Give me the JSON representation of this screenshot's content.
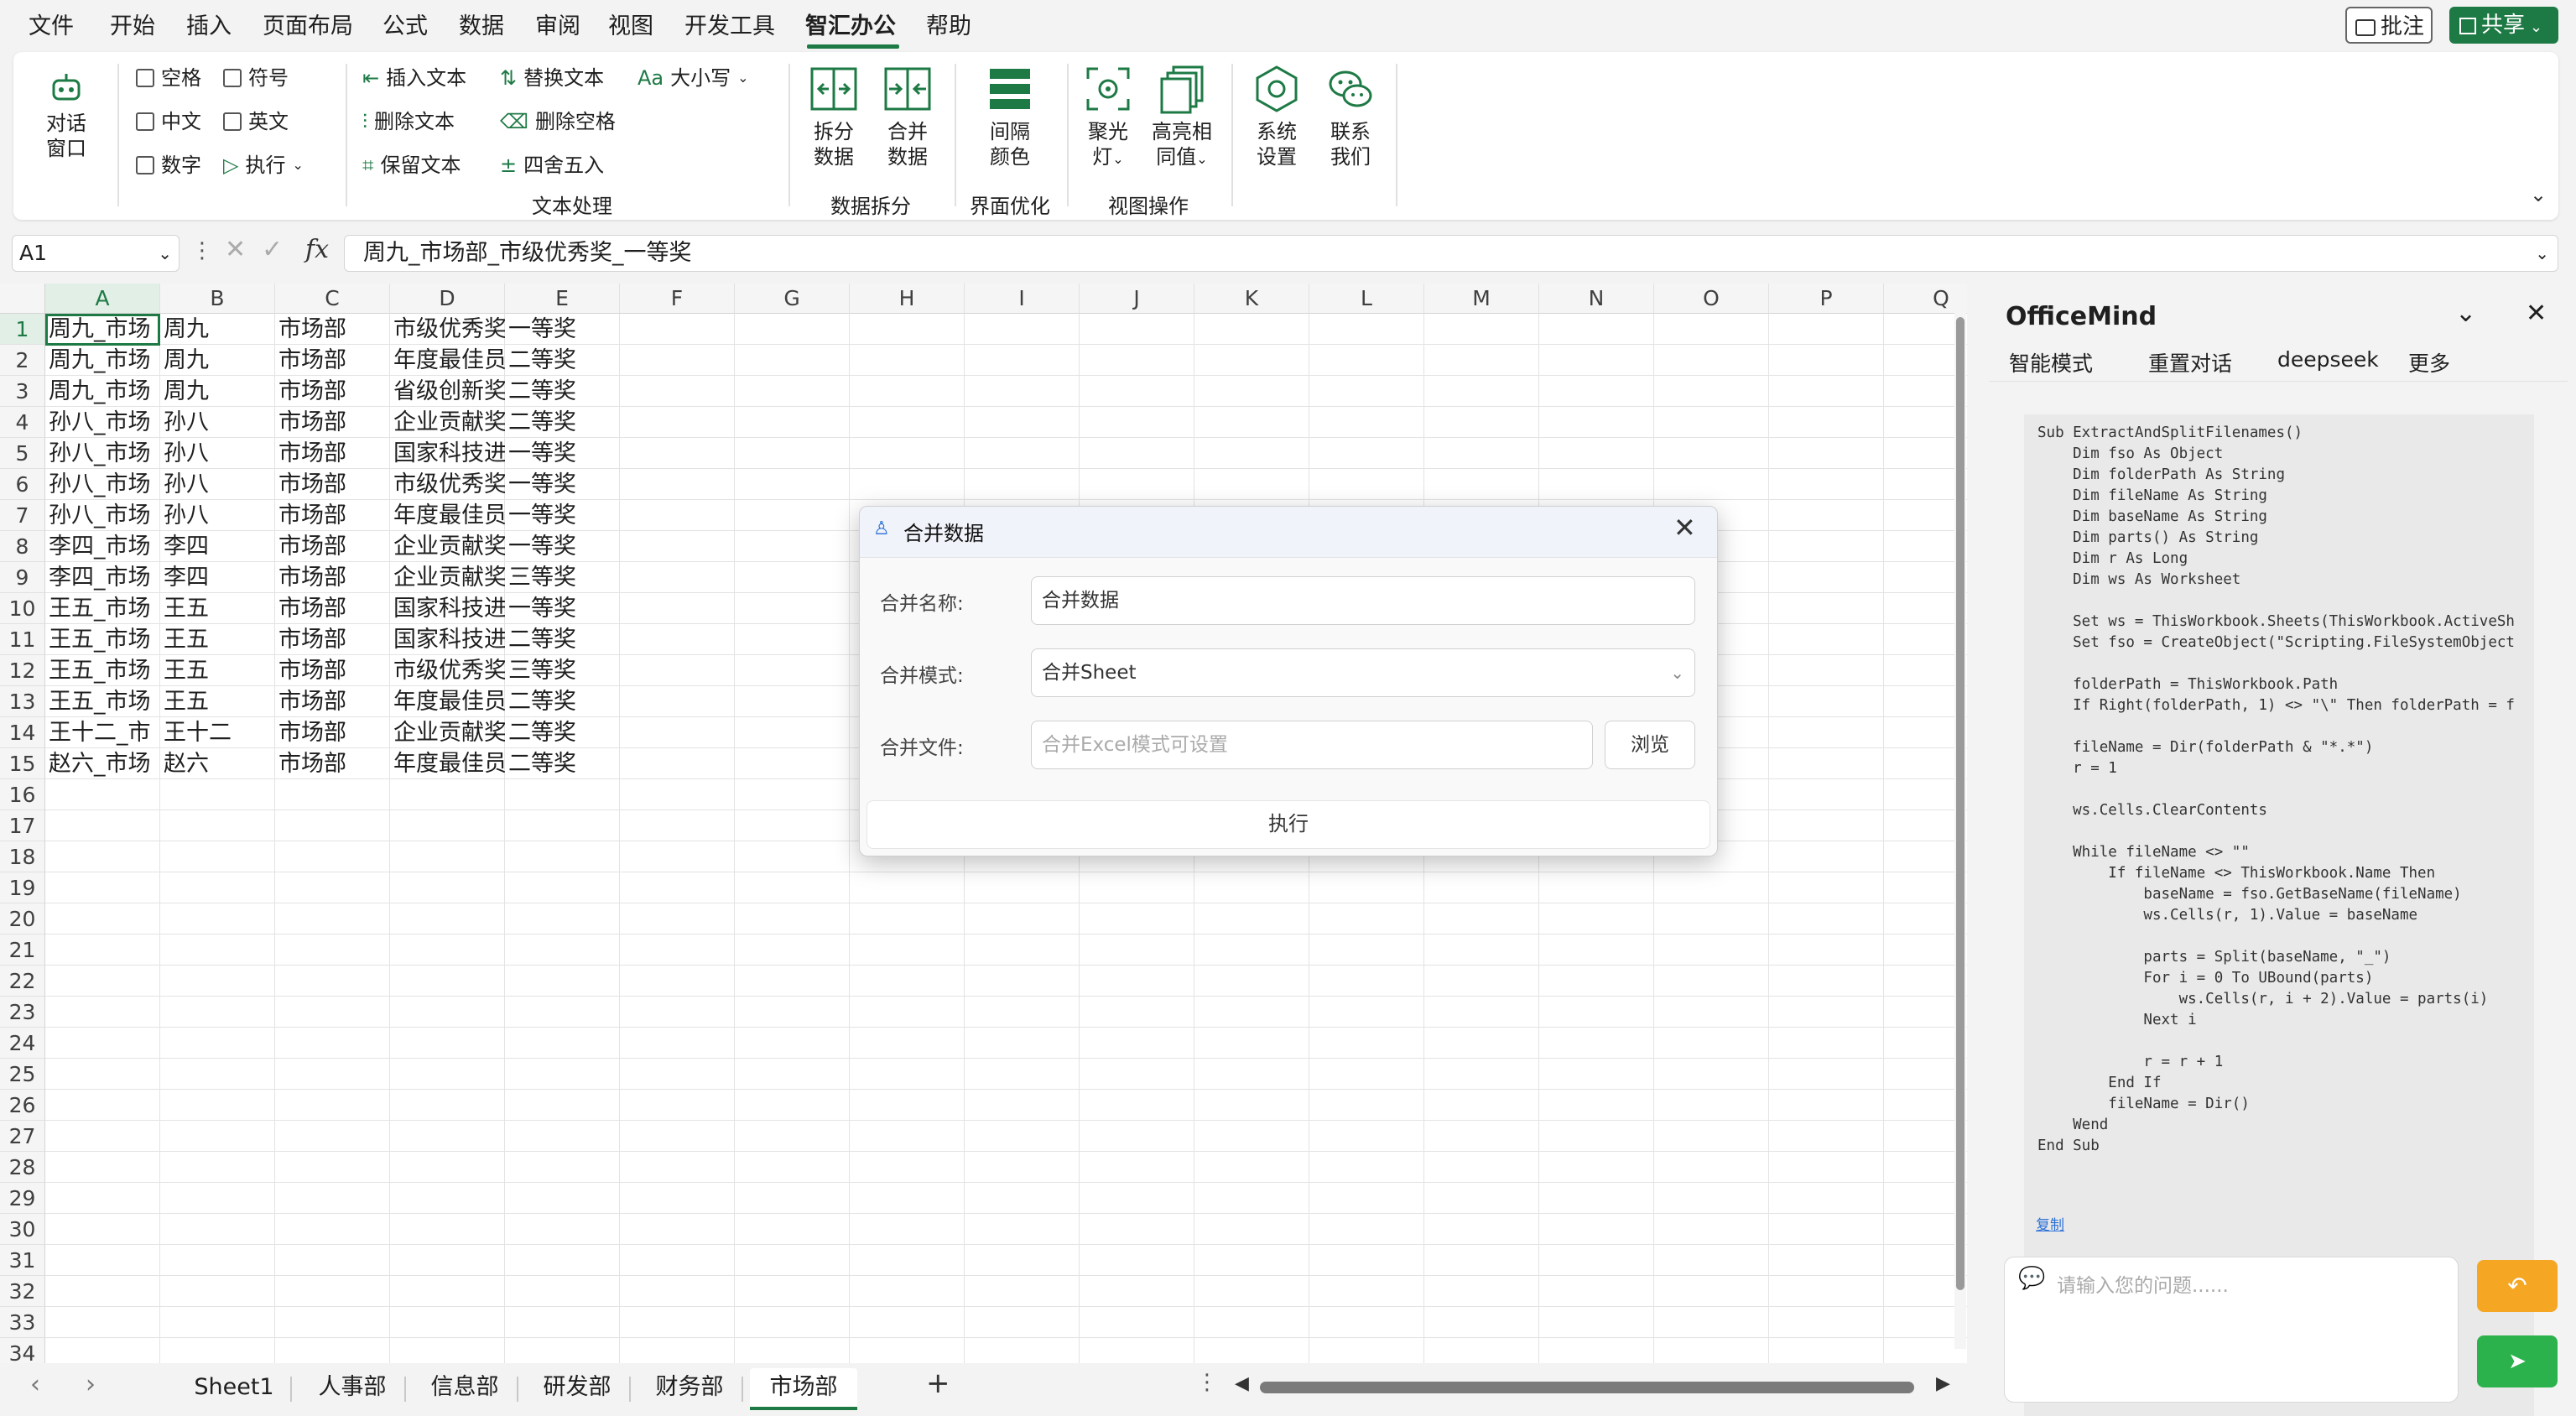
{
  "menu": {
    "items": [
      "文件",
      "开始",
      "插入",
      "页面布局",
      "公式",
      "数据",
      "审阅",
      "视图",
      "开发工具",
      "智汇办公",
      "帮助"
    ],
    "active": "智汇办公",
    "comment_button": "批注",
    "share_button": "共享"
  },
  "ribbon": {
    "chat": [
      "对话",
      "窗口"
    ],
    "checkboxes": {
      "space": "空格",
      "symbol": "符号",
      "chinese": "中文",
      "english": "英文",
      "number": "数字",
      "execute": "执行"
    },
    "text": {
      "insert": "插入文本",
      "replace": "替换文本",
      "case": "大小写",
      "delete": "删除文本",
      "delete_space": "删除空格",
      "keep": "保留文本",
      "round": "四舍五入",
      "case_prefix": "Aa"
    },
    "group_text": "文本处理",
    "split": [
      "拆分",
      "数据"
    ],
    "merge": [
      "合并",
      "数据"
    ],
    "group_split": "数据拆分",
    "interval": [
      "间隔",
      "颜色"
    ],
    "group_ui": "界面优化",
    "spotlight": [
      "聚光",
      "灯"
    ],
    "highlight": [
      "高亮相",
      "同值"
    ],
    "group_view": "视图操作",
    "settings": [
      "系统",
      "设置"
    ],
    "contact": [
      "联系",
      "我们"
    ]
  },
  "formula": {
    "name_box": "A1",
    "fx": "fx",
    "content": "周九_市场部_市级优秀奖_一等奖"
  },
  "sheet": {
    "columns": [
      "A",
      "B",
      "C",
      "D",
      "E",
      "F",
      "G",
      "H",
      "I",
      "J",
      "K",
      "L",
      "M",
      "N",
      "O",
      "P",
      "Q"
    ],
    "rows": [
      "1",
      "2",
      "3",
      "4",
      "5",
      "6",
      "7",
      "8",
      "9",
      "10",
      "11",
      "12",
      "13",
      "14",
      "15",
      "16",
      "17",
      "18",
      "19",
      "20",
      "21",
      "22",
      "23",
      "24",
      "25",
      "26",
      "27",
      "28",
      "29",
      "30",
      "31",
      "32",
      "33",
      "34"
    ],
    "data": [
      [
        "周九_市场",
        "周九",
        "市场部",
        "市级优秀奖",
        "一等奖"
      ],
      [
        "周九_市场",
        "周九",
        "市场部",
        "年度最佳员",
        "二等奖"
      ],
      [
        "周九_市场",
        "周九",
        "市场部",
        "省级创新奖",
        "二等奖"
      ],
      [
        "孙八_市场",
        "孙八",
        "市场部",
        "企业贡献奖",
        "二等奖"
      ],
      [
        "孙八_市场",
        "孙八",
        "市场部",
        "国家科技进",
        "一等奖"
      ],
      [
        "孙八_市场",
        "孙八",
        "市场部",
        "市级优秀奖",
        "一等奖"
      ],
      [
        "孙八_市场",
        "孙八",
        "市场部",
        "年度最佳员",
        "一等奖"
      ],
      [
        "李四_市场",
        "李四",
        "市场部",
        "企业贡献奖",
        "一等奖"
      ],
      [
        "李四_市场",
        "李四",
        "市场部",
        "企业贡献奖",
        "三等奖"
      ],
      [
        "王五_市场",
        "王五",
        "市场部",
        "国家科技进",
        "一等奖"
      ],
      [
        "王五_市场",
        "王五",
        "市场部",
        "国家科技进",
        "二等奖"
      ],
      [
        "王五_市场",
        "王五",
        "市场部",
        "市级优秀奖",
        "三等奖"
      ],
      [
        "王五_市场",
        "王五",
        "市场部",
        "年度最佳员",
        "二等奖"
      ],
      [
        "王十二_市",
        "王十二",
        "市场部",
        "企业贡献奖",
        "二等奖"
      ],
      [
        "赵六_市场",
        "赵六",
        "市场部",
        "年度最佳员",
        "二等奖"
      ]
    ]
  },
  "tabs": {
    "sheets": [
      "Sheet1",
      "人事部",
      "信息部",
      "研发部",
      "财务部",
      "市场部"
    ],
    "active": "市场部",
    "add": "+"
  },
  "dialog": {
    "title": "合并数据",
    "name_label": "合并名称:",
    "name_value": "合并数据",
    "mode_label": "合并模式:",
    "mode_value": "合并Sheet",
    "file_label": "合并文件:",
    "file_placeholder": "合并Excel模式可设置",
    "browse": "浏览",
    "execute": "执行"
  },
  "panel": {
    "title": "OfficeMind",
    "tabs": [
      "智能模式",
      "重置对话",
      "deepseek",
      "更多"
    ],
    "code": "Sub ExtractAndSplitFilenames()\n    Dim fso As Object\n    Dim folderPath As String\n    Dim fileName As String\n    Dim baseName As String\n    Dim parts() As String\n    Dim r As Long\n    Dim ws As Worksheet\n\n    Set ws = ThisWorkbook.Sheets(ThisWorkbook.ActiveSh\n    Set fso = CreateObject(\"Scripting.FileSystemObject\n\n    folderPath = ThisWorkbook.Path\n    If Right(folderPath, 1) <> \"\\\" Then folderPath = f\n\n    fileName = Dir(folderPath & \"*.*\")\n    r = 1\n\n    ws.Cells.ClearContents\n\n    While fileName <> \"\"\n        If fileName <> ThisWorkbook.Name Then\n            baseName = fso.GetBaseName(fileName)\n            ws.Cells(r, 1).Value = baseName\n\n            parts = Split(baseName, \"_\")\n            For i = 0 To UBound(parts)\n                ws.Cells(r, i + 2).Value = parts(i)\n            Next i\n\n            r = r + 1\n        End If\n        fileName = Dir()\n    Wend\nEnd Sub",
    "copy": "复制",
    "input_placeholder": "请输入您的问题......"
  },
  "colors": {
    "accent": "#1e7a45",
    "orange": "#f5a623",
    "green_button": "#2bb24c"
  }
}
